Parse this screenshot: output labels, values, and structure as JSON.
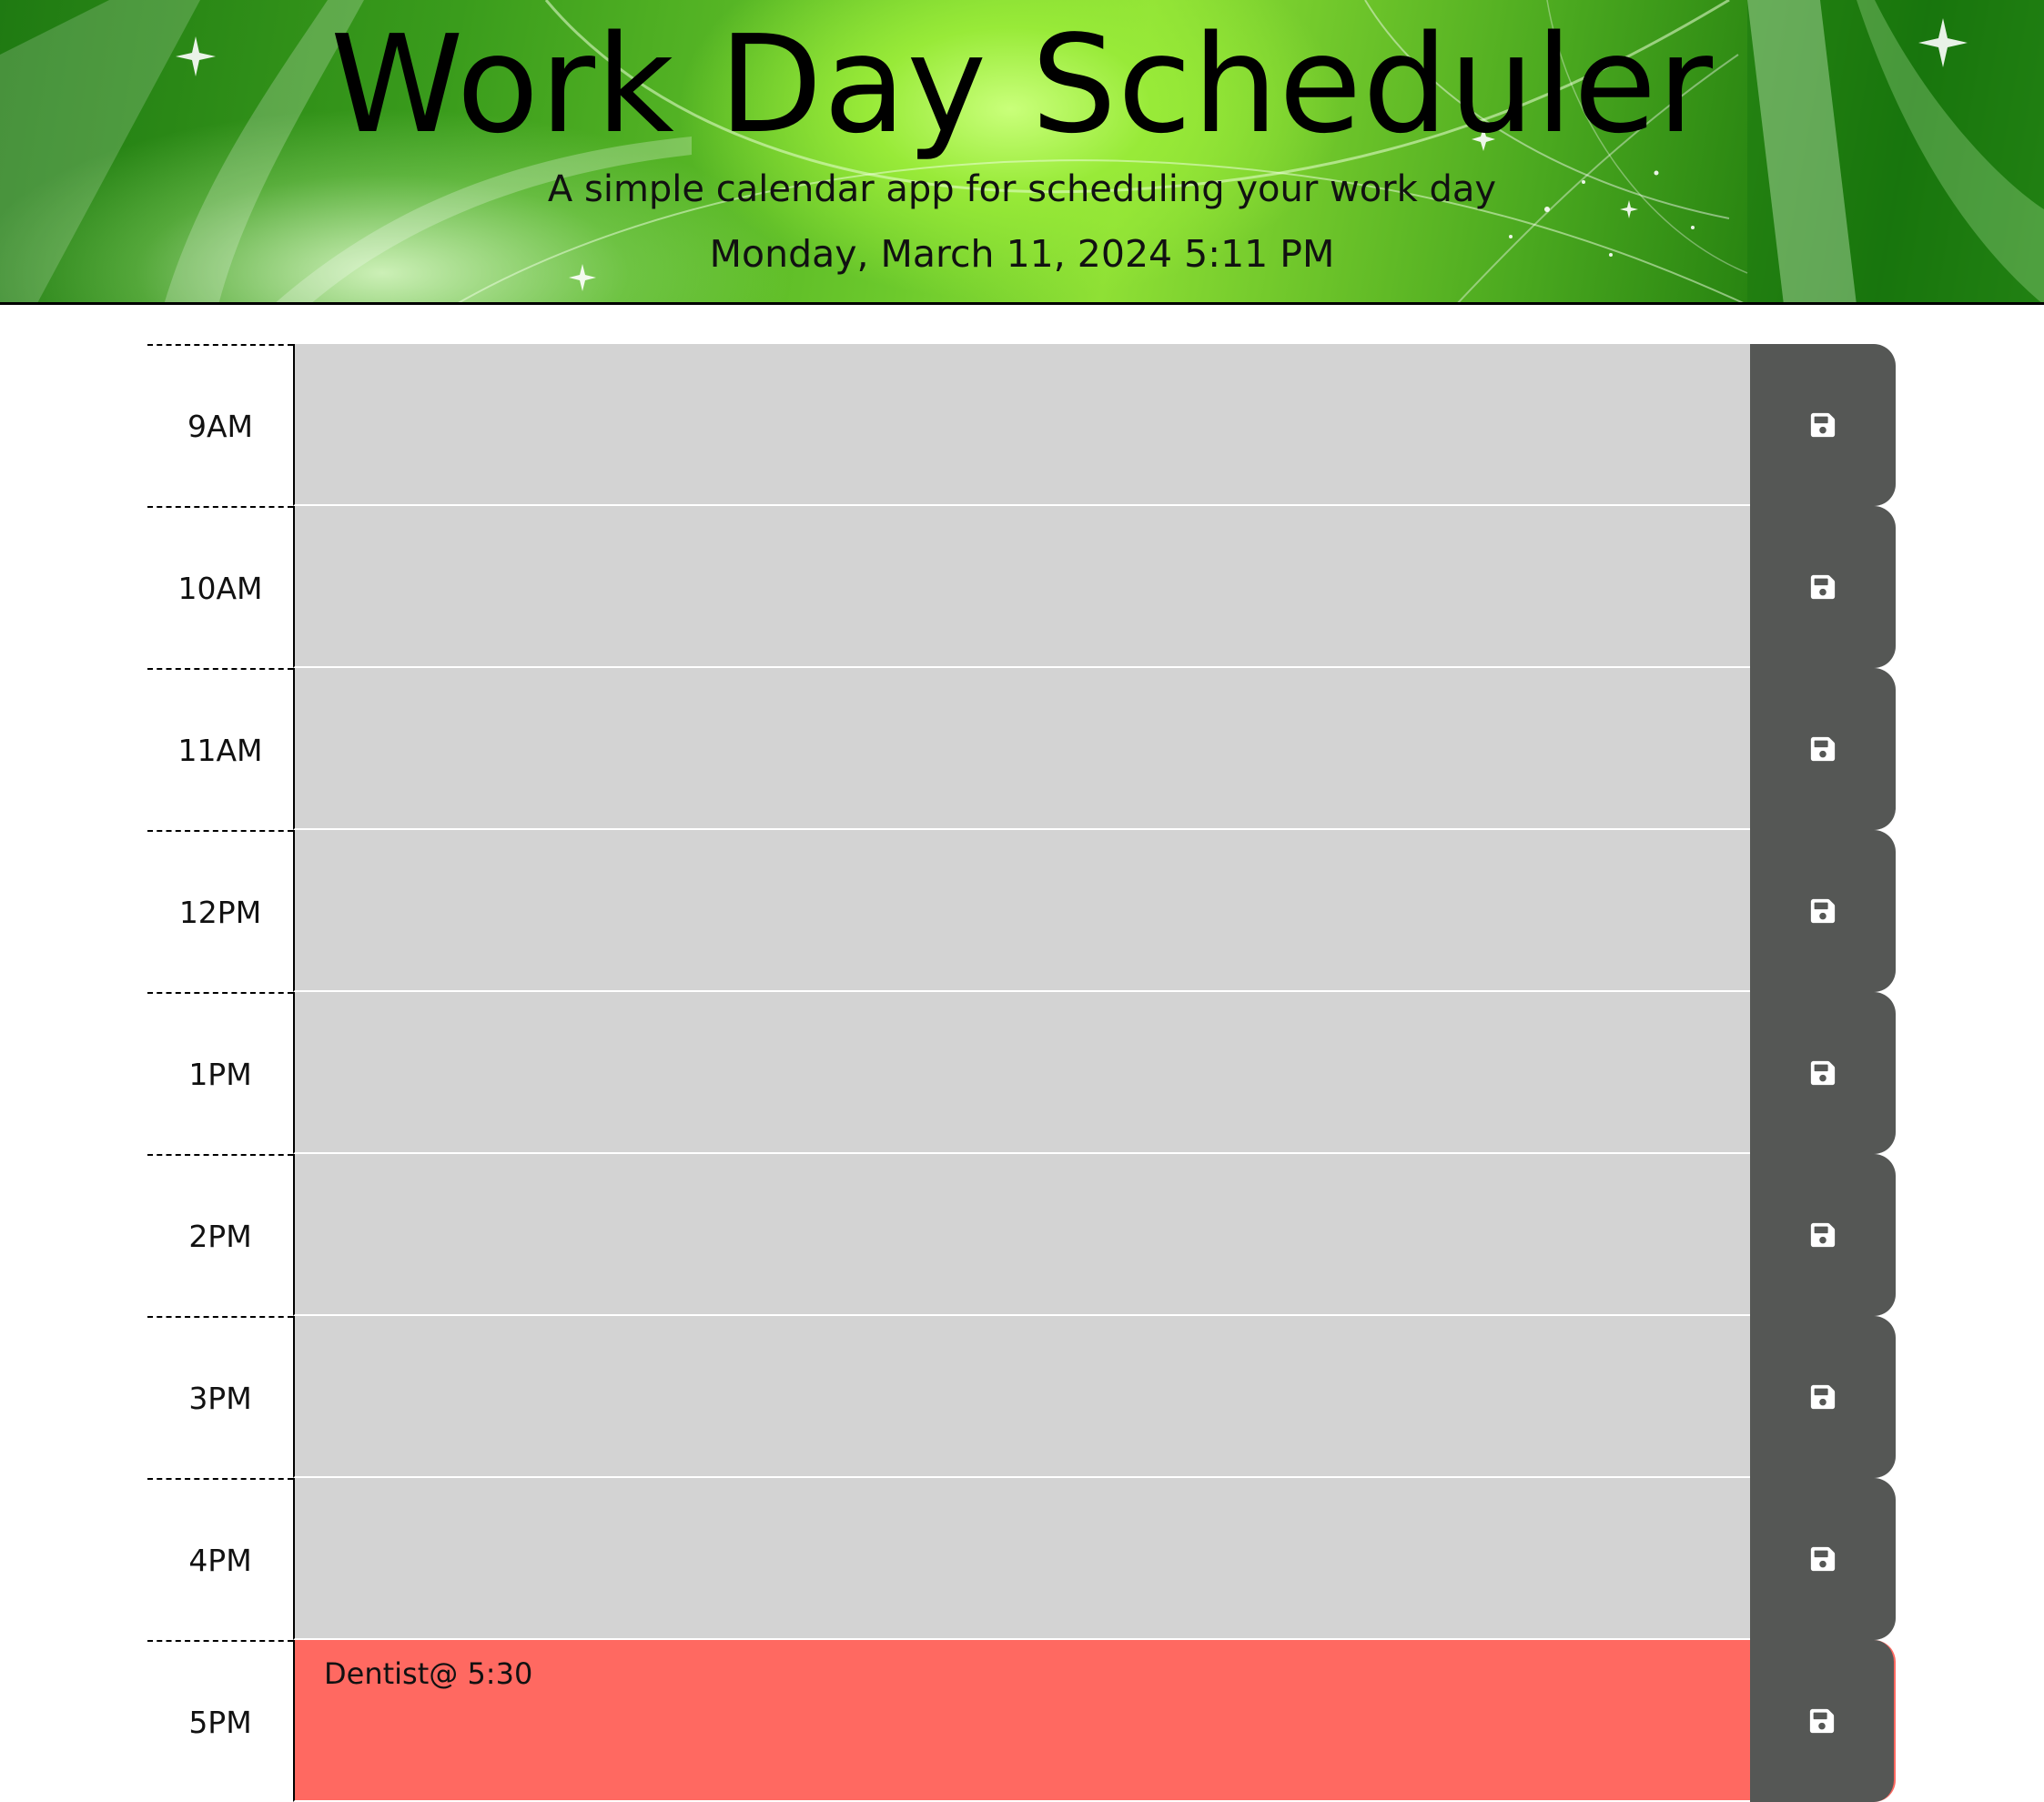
{
  "header": {
    "title": "Work Day Scheduler",
    "subtitle": "A simple calendar app for scheduling your work day",
    "current_day": "Monday, March 11, 2024 5:11 PM"
  },
  "colors": {
    "past": "#d3d3d3",
    "present": "#ff6961",
    "save_button": "#555755",
    "header_green": "#6cc92c"
  },
  "save_icon": "floppy-disk-icon",
  "time_blocks": [
    {
      "hour": "9AM",
      "text": "",
      "state": "past"
    },
    {
      "hour": "10AM",
      "text": "",
      "state": "past"
    },
    {
      "hour": "11AM",
      "text": "",
      "state": "past"
    },
    {
      "hour": "12PM",
      "text": "",
      "state": "past"
    },
    {
      "hour": "1PM",
      "text": "",
      "state": "past"
    },
    {
      "hour": "2PM",
      "text": "",
      "state": "past"
    },
    {
      "hour": "3PM",
      "text": "",
      "state": "past"
    },
    {
      "hour": "4PM",
      "text": "",
      "state": "past"
    },
    {
      "hour": "5PM",
      "text": "Dentist@ 5:30",
      "state": "present"
    }
  ]
}
